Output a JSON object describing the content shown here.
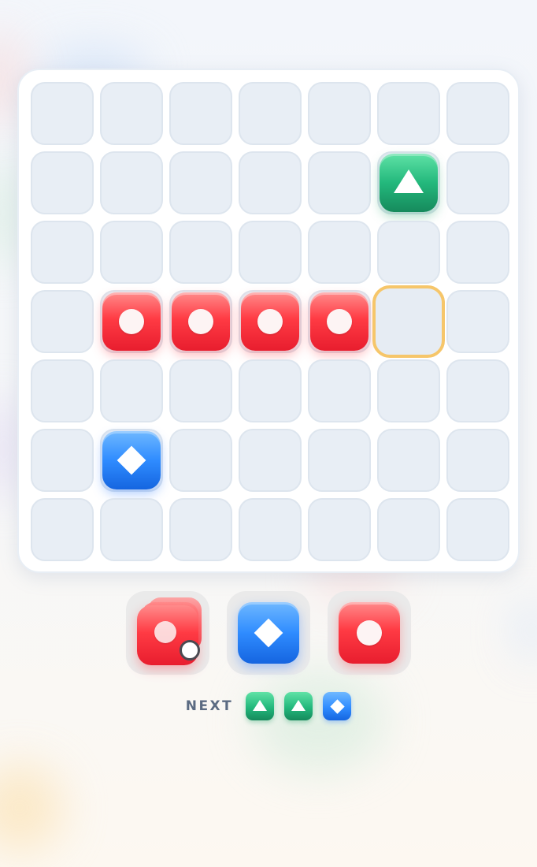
{
  "colors": {
    "red": "#ff3b44",
    "green": "#23b87c",
    "blue": "#2f8cff",
    "highlight": "#f6c66a",
    "empty_cell": "#e8eef5"
  },
  "board": {
    "rows": 7,
    "cols": 7,
    "highlighted_cell": {
      "row": 3,
      "col": 5
    },
    "tiles": [
      {
        "row": 1,
        "col": 5,
        "color": "green",
        "shape": "triangle-icon"
      },
      {
        "row": 3,
        "col": 1,
        "color": "red",
        "shape": "circle-icon"
      },
      {
        "row": 3,
        "col": 2,
        "color": "red",
        "shape": "circle-icon"
      },
      {
        "row": 3,
        "col": 3,
        "color": "red",
        "shape": "circle-icon"
      },
      {
        "row": 3,
        "col": 4,
        "color": "red",
        "shape": "circle-icon"
      },
      {
        "row": 5,
        "col": 1,
        "color": "blue",
        "shape": "diamond-icon"
      }
    ]
  },
  "tray": [
    {
      "color": "red",
      "shape": "circle-icon",
      "stacked": true
    },
    {
      "color": "blue",
      "shape": "diamond-icon",
      "stacked": false
    },
    {
      "color": "red",
      "shape": "circle-icon",
      "stacked": false
    }
  ],
  "next": {
    "label": "NEXT",
    "pieces": [
      {
        "color": "green",
        "shape": "triangle-icon"
      },
      {
        "color": "green",
        "shape": "triangle-icon"
      },
      {
        "color": "blue",
        "shape": "diamond-icon"
      }
    ]
  }
}
